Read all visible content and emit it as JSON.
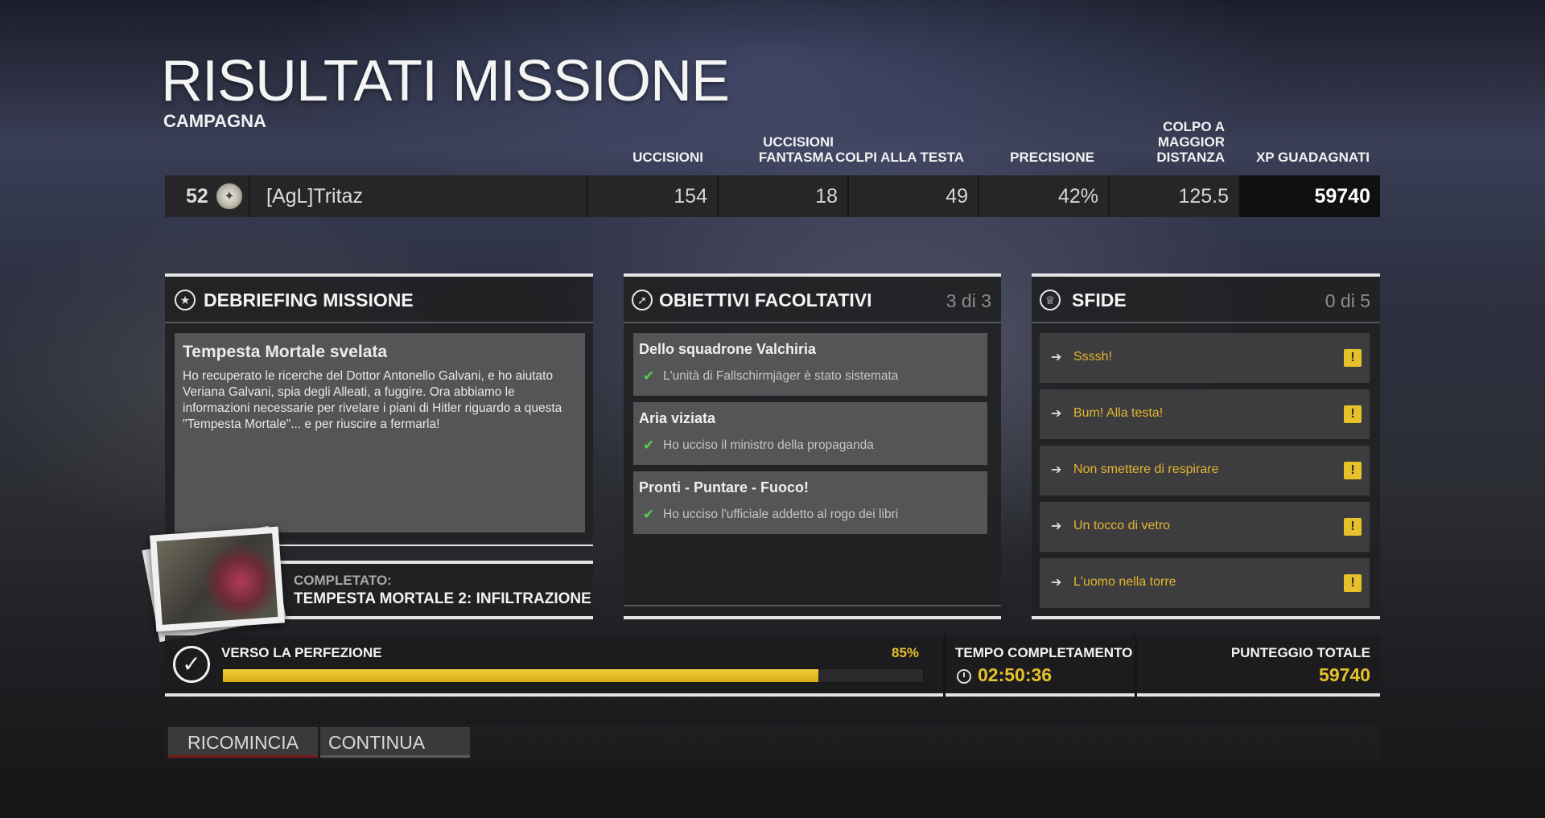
{
  "header": {
    "title": "RISULTATI MISSIONE",
    "subtitle": "CAMPAGNA"
  },
  "columns": {
    "kills": "UCCISIONI",
    "ghost_kills": "UCCISIONI FANTASMA",
    "headshots": "COLPI ALLA TESTA",
    "accuracy": "PRECISIONE",
    "longest_shot": "COLPO A MAGGIOR DISTANZA",
    "xp": "XP GUADAGNATI"
  },
  "player": {
    "level": "52",
    "name": "[AgL]Tritaz",
    "kills": "154",
    "ghost_kills": "18",
    "headshots": "49",
    "accuracy": "42%",
    "longest_shot": "125.5",
    "xp": "59740"
  },
  "debriefing": {
    "title": "DEBRIEFING MISSIONE",
    "icon": "star-icon",
    "story_title": "Tempesta Mortale svelata",
    "story_text": "Ho recuperato le ricerche del Dottor Antonello Galvani, e ho aiutato Veriana Galvani, spia degli Alleati, a fuggire. Ora abbiamo le informazioni necessarie per rivelare i piani di Hitler riguardo a questa \"Tempesta Mortale\"... e per riuscire a fermarla!",
    "completed_label": "COMPLETATO:",
    "completed_mission": "TEMPESTA MORTALE 2: INFILTRAZIONE"
  },
  "objectives": {
    "title": "OBIETTIVI FACOLTATIVI",
    "icon": "compass-icon",
    "count": "3 di 3",
    "items": [
      {
        "title": "Dello squadrone Valchiria",
        "desc": "L'unità di Fallschirmjäger è stato sistemata"
      },
      {
        "title": "Aria viziata",
        "desc": "Ho ucciso il ministro della propaganda"
      },
      {
        "title": "Pronti - Puntare - Fuoco!",
        "desc": "Ho ucciso l'ufficiale addetto al rogo dei libri"
      }
    ]
  },
  "challenges": {
    "title": "SFIDE",
    "icon": "trophy-icon",
    "count": "0 di 5",
    "items": [
      {
        "label": "Ssssh!"
      },
      {
        "label": "Bum! Alla testa!"
      },
      {
        "label": "Non smettere di respirare"
      },
      {
        "label": "Un tocco di vetro"
      },
      {
        "label": "L'uomo nella torre"
      }
    ]
  },
  "perfection": {
    "label": "VERSO LA PERFEZIONE",
    "percent_text": "85%",
    "progress": 0.85
  },
  "completion_time": {
    "label": "TEMPO COMPLETAMENTO",
    "value": "02:50:36"
  },
  "total_score": {
    "label": "PUNTEGGIO TOTALE",
    "value": "59740"
  },
  "buttons": {
    "restart": "RICOMINCIA",
    "continue": "CONTINUA"
  },
  "colors": {
    "accent": "#e6c12a",
    "check": "#53d14d",
    "restart_underline": "#7a1c1c"
  }
}
